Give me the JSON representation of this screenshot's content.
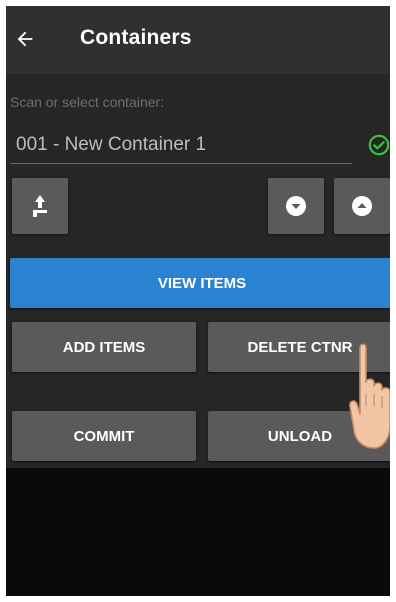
{
  "app": {
    "title": "Containers"
  },
  "icons": {
    "back": "arrow-left-icon",
    "valid": "check-circle-icon",
    "scan": "scanner-icon",
    "down": "chevron-down-circle-icon",
    "up": "chevron-up-circle-icon"
  },
  "container_select": {
    "label": "Scan or select container:",
    "value": "001 - New Container 1"
  },
  "buttons": {
    "view_items": "VIEW ITEMS",
    "add_items": "ADD ITEMS",
    "delete_ctnr": "DELETE CTNR",
    "commit": "COMMIT",
    "unload": "UNLOAD"
  },
  "colors": {
    "accent": "#2a82d0",
    "valid": "#3fbf3f",
    "button": "#5a5a5a",
    "appbar": "#303030"
  }
}
